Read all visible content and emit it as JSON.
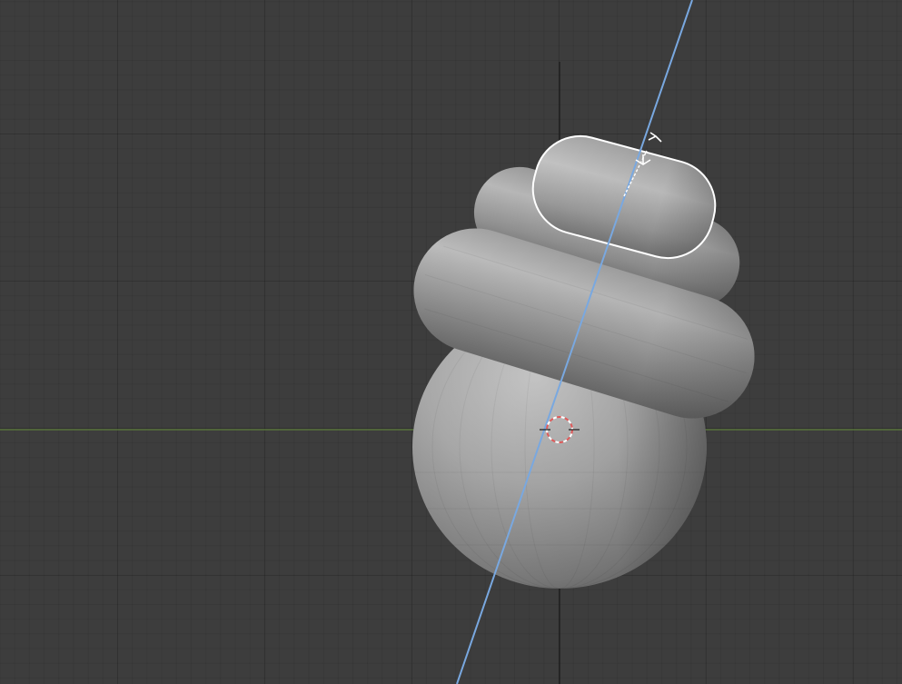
{
  "app": {
    "title": "",
    "view": "3D viewport"
  },
  "viewport": {
    "background_color": "#3d3d3d",
    "grid_color": "#353535",
    "x_axis_color": "#5b7d3b",
    "z_axis_color": "#1a1a1a",
    "symmetry_axis_color": "#79a8e0",
    "cursor_colors": [
      "#e05a5a",
      "#ffffff"
    ]
  },
  "scene": {
    "objects": [
      {
        "name": "sphere-base",
        "type": "sphere"
      },
      {
        "name": "ring-lower",
        "type": "torus"
      },
      {
        "name": "ring-middle",
        "type": "torus"
      },
      {
        "name": "ring-top-selected",
        "type": "capsule",
        "selected": true
      }
    ],
    "gizmo": {
      "handles": [
        "arrow-up-icon",
        "arrow-down-icon"
      ]
    },
    "cursor_icon": "3d-cursor-icon"
  }
}
